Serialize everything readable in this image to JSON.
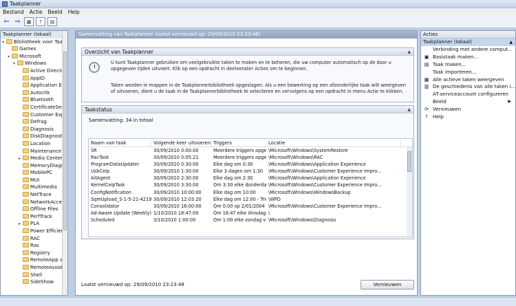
{
  "window": {
    "title": "Taakplanner"
  },
  "menu": [
    "Bestand",
    "Actie",
    "Beeld",
    "Help"
  ],
  "toolbar": {
    "back": "⇐",
    "forward": "⇒",
    "btn3": "▦",
    "btn4": "?",
    "btn5": "▤"
  },
  "tree": {
    "root": "Taakplanner (lokaal)",
    "library": "Bibliotheek voor Taakplanner",
    "items": [
      {
        "label": "Games",
        "indent": 1
      },
      {
        "label": "Microsoft",
        "indent": 1,
        "expanded": true
      },
      {
        "label": "Windows",
        "indent": 2,
        "expanded": true
      },
      {
        "label": "Active Directory",
        "indent": 3
      },
      {
        "label": "AppID",
        "indent": 3
      },
      {
        "label": "Application Exp",
        "indent": 3
      },
      {
        "label": "Autochk",
        "indent": 3
      },
      {
        "label": "Bluetooth",
        "indent": 3
      },
      {
        "label": "CertificateServi",
        "indent": 3
      },
      {
        "label": "Customer Expe",
        "indent": 3
      },
      {
        "label": "Defrag",
        "indent": 3
      },
      {
        "label": "Diagnosis",
        "indent": 3
      },
      {
        "label": "DiskDiagnostic",
        "indent": 3
      },
      {
        "label": "Location",
        "indent": 3
      },
      {
        "label": "Maintenance",
        "indent": 3
      },
      {
        "label": "Media Center",
        "indent": 3,
        "collapsed": true
      },
      {
        "label": "MemoryDiagno",
        "indent": 3
      },
      {
        "label": "MobilePC",
        "indent": 3
      },
      {
        "label": "MUI",
        "indent": 3
      },
      {
        "label": "Multimedia",
        "indent": 3
      },
      {
        "label": "NetTrace",
        "indent": 3
      },
      {
        "label": "NetworkAccess",
        "indent": 3
      },
      {
        "label": "Offline Files",
        "indent": 3
      },
      {
        "label": "PerfTrack",
        "indent": 3
      },
      {
        "label": "PLA",
        "indent": 3,
        "collapsed": true
      },
      {
        "label": "Power Efficienc",
        "indent": 3
      },
      {
        "label": "RAC",
        "indent": 3
      },
      {
        "label": "Ras",
        "indent": 3
      },
      {
        "label": "Registry",
        "indent": 3
      },
      {
        "label": "RemoteApp and",
        "indent": 3
      },
      {
        "label": "RemoteAssistar",
        "indent": 3
      },
      {
        "label": "Shell",
        "indent": 3
      },
      {
        "label": "SideShow",
        "indent": 3
      }
    ]
  },
  "main": {
    "header": "Samenvatting van Taakplanner (laatst vernieuwd op: 29/09/2010 23:23:48)",
    "overview": {
      "title": "Overzicht van Taakplanner",
      "para1": "U kunt Taakplanner gebruiken om veelgebruikte taken te maken en te beheren, die uw computer automatisch op de door u opgegeven tijden uitvoert. Klik op een opdracht in deelvenster Acties om te beginnen.",
      "para2": "Taken worden in mappen in de Taakplannerbibliotheek opgeslagen. Als u een bewerking op een afzonderlijke taak wilt weergeven of uitvoeren, dient u de taak in de Taakplannerbibliotheek te selecteren en vervolgens op een opdracht in menu Actie te klikken."
    },
    "status": {
      "title": "Taakstatus",
      "summary": "Samenvatting: 34 in totaal"
    },
    "table": {
      "headers": [
        "Naam van taak",
        "Volgende keer uitvoeren",
        "Triggers",
        "Locatie"
      ],
      "rows": [
        [
          "SR",
          "30/09/2010 0:00:00",
          "Meerdere triggers opge...",
          "\\Microsoft\\Windows\\SystemRestore"
        ],
        [
          "RacTask",
          "30/09/2010 0:05:21",
          "Meerdere triggers opge...",
          "\\Microsoft\\Windows\\RAC"
        ],
        [
          "ProgramDataUpdater",
          "30/09/2010 0:30:00",
          "Elke dag om 0:30",
          "\\Microsoft\\Windows\\Application Experience"
        ],
        [
          "UsbCeip",
          "30/09/2010 1:30:00",
          "Elke 3 dagen om 1:30",
          "\\Microsoft\\Windows\\Customer Experience Impro..."
        ],
        [
          "AitAgent",
          "30/09/2010 2:30:00",
          "Elke dag om 2:30",
          "\\Microsoft\\Windows\\Application Experience"
        ],
        [
          "KernelCeipTask",
          "30/09/2010 3:30:00",
          "Om 3:30 elke donderdag...",
          "\\Microsoft\\Windows\\Customer Experience Impro..."
        ],
        [
          "ConfigNotification",
          "30/09/2010 10:00:00",
          "Elke dag om 10:00",
          "\\Microsoft\\Windows\\WindowsBackup"
        ],
        [
          "SqmUpload_S-1-5-21-4219658025-...",
          "30/09/2010 12:03:20",
          "Elke dag om 12:00 - Trig...",
          "\\WPD"
        ],
        [
          "Consolidator",
          "30/09/2010 16:00:00",
          "Om 0:00 op 2/01/2004 - ...",
          "\\Microsoft\\Windows\\Customer Experience Impro..."
        ],
        [
          "Ad-Aware Update (Weekly)",
          "1/10/2010 18:47:00",
          "Om 18:47 elke dinsdag, ...",
          "\\"
        ],
        [
          "Scheduled",
          "3/10/2010 1:00:00",
          "Om 1:00 elke zondag va...",
          "\\Microsoft\\Windows\\Diagnosis"
        ]
      ]
    },
    "footer": "Laatst vernieuwd op: 29/09/2010 23:23:48",
    "refresh": "Vernieuwen"
  },
  "actions": {
    "title": "Acties",
    "subtitle": "Taakplanner (lokaal)",
    "items": [
      {
        "label": "Verbinding met andere comput...",
        "icon": ""
      },
      {
        "label": "Basistaak maken...",
        "icon": "▣"
      },
      {
        "label": "Taak maken...",
        "icon": "▤"
      },
      {
        "label": "Taak importeren...",
        "icon": ""
      },
      {
        "label": "Alle actieve taken weergeven",
        "icon": "▦"
      },
      {
        "label": "De geschiedenis van alle taken i...",
        "icon": "▥"
      },
      {
        "label": "AT-serviceaccount configureren",
        "icon": ""
      },
      {
        "label": "Beeld",
        "icon": "",
        "submenu": true
      },
      {
        "label": "Vernieuwen",
        "icon": "⟳"
      },
      {
        "label": "Help",
        "icon": "?"
      }
    ]
  }
}
